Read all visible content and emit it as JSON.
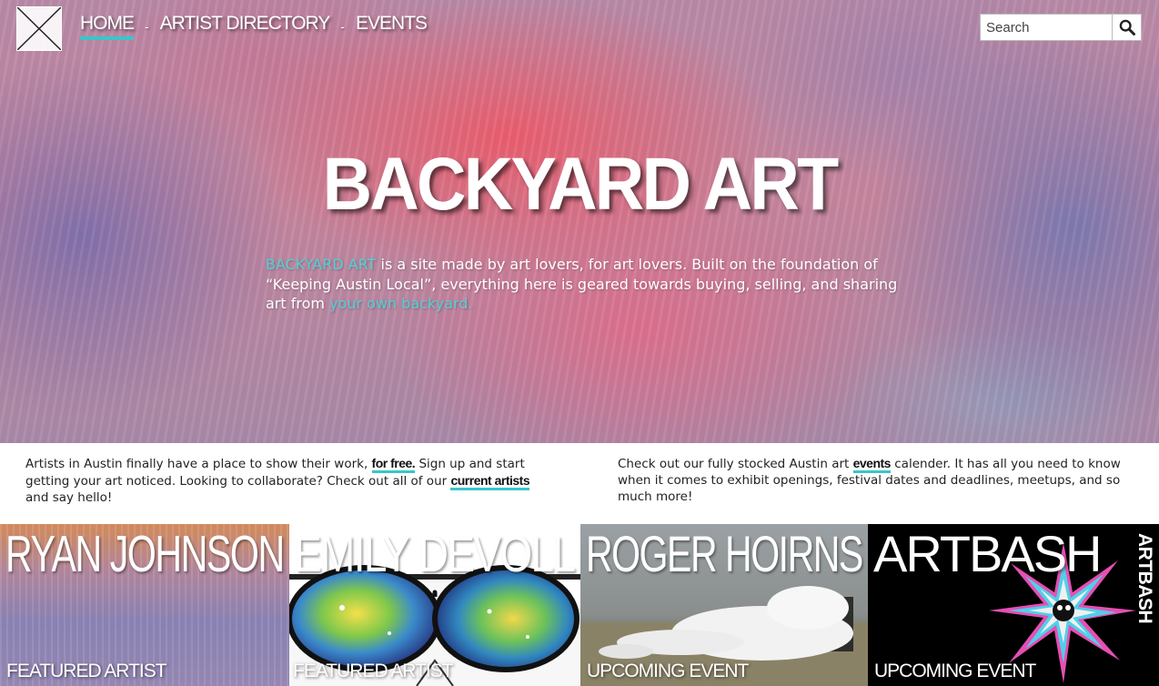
{
  "nav": {
    "items": [
      {
        "label": "HOME",
        "active": true
      },
      {
        "label": "ARTIST DIRECTORY",
        "active": false
      },
      {
        "label": "EVENTS",
        "active": false
      }
    ],
    "separator": "-"
  },
  "search": {
    "placeholder": "Search",
    "icon": "search-icon"
  },
  "hero": {
    "title": "BACKYARD ART",
    "intro_highlight": "BACKYARD ART",
    "intro_text": " is a site made by art lovers, for art lovers. Built on the foundation of “Keeping Austin Local”, everything here is geared towards buying, selling, and sharing art from ",
    "intro_link": "your own backyard."
  },
  "info": {
    "left": {
      "text1": "Artists in Austin finally have a place to show their work, ",
      "link1": "for free.",
      "text2": " Sign up and start getting your art noticed. Looking to collaborate? Check out all of our ",
      "link2": "current artists",
      "text3": " and say hello!"
    },
    "right": {
      "text1": "Check out our fully stocked Austin art ",
      "link1": "events",
      "text2": " calender. It has all you need to know when it comes to exhibit openings, festival dates and deadlines, meetups, and so much more!"
    }
  },
  "cards": [
    {
      "name": "RYAN JOHNSON",
      "tag": "FEATURED ARTIST"
    },
    {
      "name": "EMILY DEVOLL",
      "tag": "FEATURED ARTIST"
    },
    {
      "name": "ROGER HOIRNS",
      "tag": "UPCOMING EVENT"
    },
    {
      "name": "ARTBASH",
      "tag": "UPCOMING EVENT",
      "logo_text": "ARTBASH"
    }
  ],
  "colors": {
    "accent": "#39c6c8",
    "highlight": "#4fd2d6"
  }
}
